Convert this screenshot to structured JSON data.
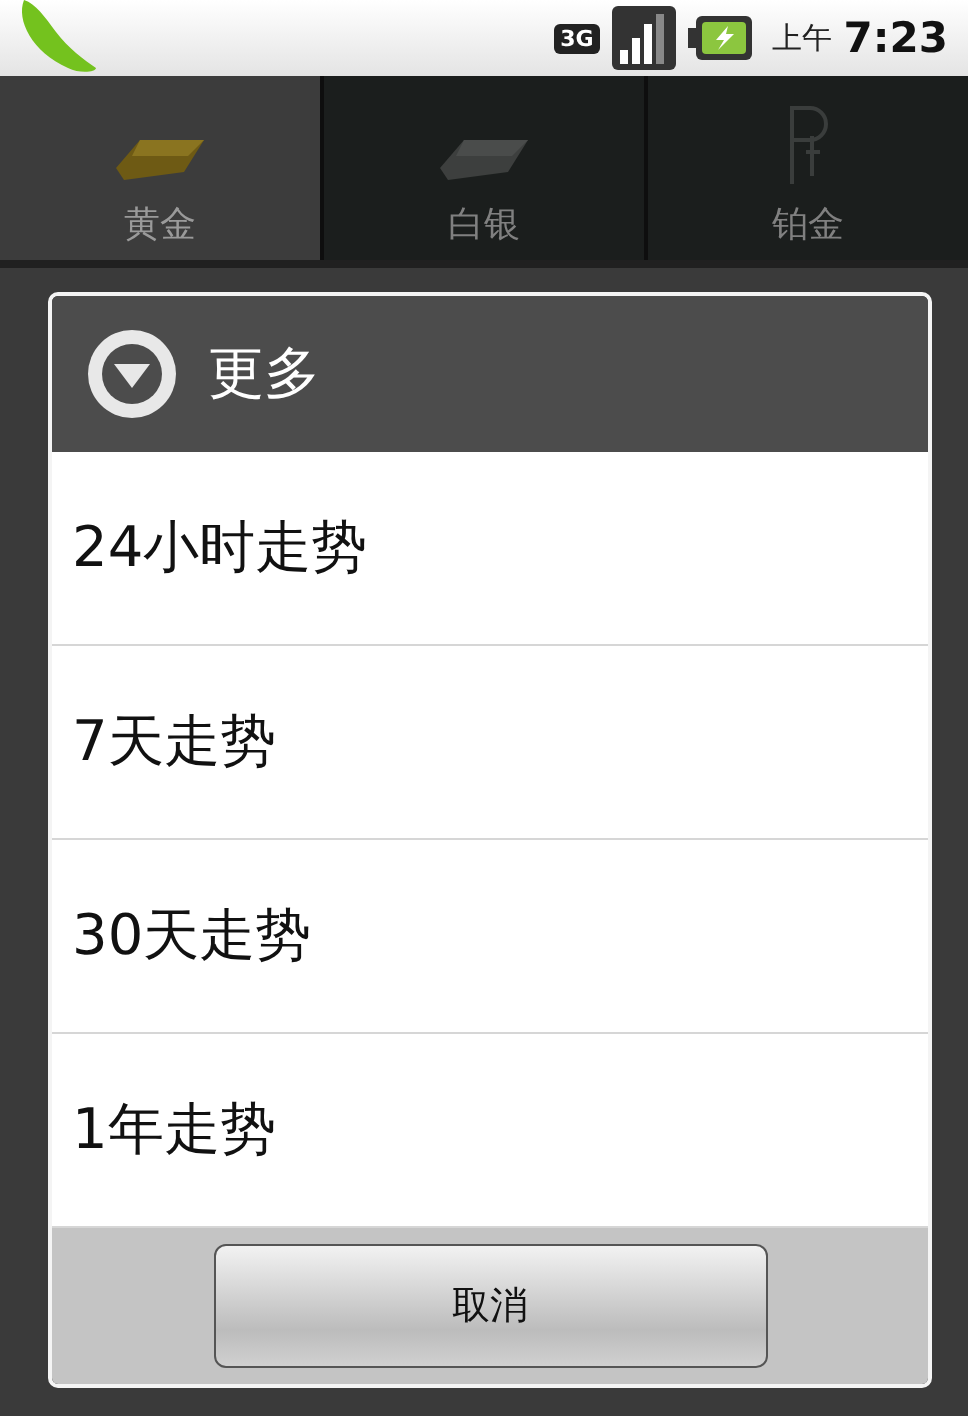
{
  "status_bar": {
    "network": "3G",
    "ampm": "上午",
    "time": "7:23"
  },
  "tabs": [
    {
      "label": "黄金",
      "kind": "gold",
      "selected": true
    },
    {
      "label": "白银",
      "kind": "silver",
      "selected": false
    },
    {
      "label": "铂金",
      "kind": "platinum",
      "selected": false
    }
  ],
  "dialog": {
    "title": "更多",
    "items": [
      "24小时走势",
      "7天走势",
      "30天走势",
      "1年走势"
    ],
    "cancel": "取消"
  }
}
